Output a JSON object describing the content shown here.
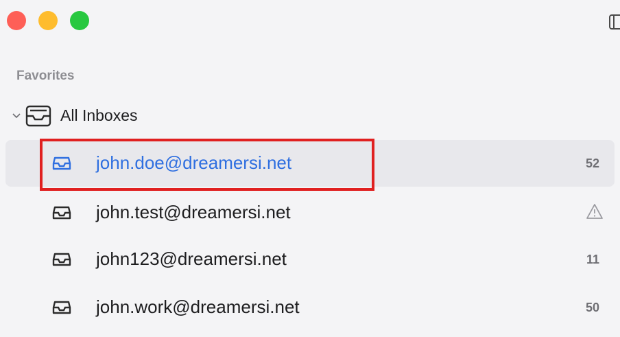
{
  "window": {
    "traffic_lights": [
      {
        "name": "close",
        "color": "#fe5f57"
      },
      {
        "name": "minimize",
        "color": "#febc2e"
      },
      {
        "name": "zoom",
        "color": "#28c840"
      }
    ]
  },
  "sidebar": {
    "section_label": "Favorites",
    "group": {
      "label": "All Inboxes",
      "icon": "tray-stack-icon",
      "expanded": true
    },
    "accounts": [
      {
        "email": "john.doe@dreamersi.net",
        "count": "52",
        "selected": true
      },
      {
        "email": "john.test@dreamersi.net",
        "status": "warning"
      },
      {
        "email": "john123@dreamersi.net",
        "count": "11"
      },
      {
        "email": "john.work@dreamersi.net",
        "count": "50"
      }
    ]
  },
  "colors": {
    "accent": "#2f6fe0",
    "highlight": "#e02020"
  }
}
